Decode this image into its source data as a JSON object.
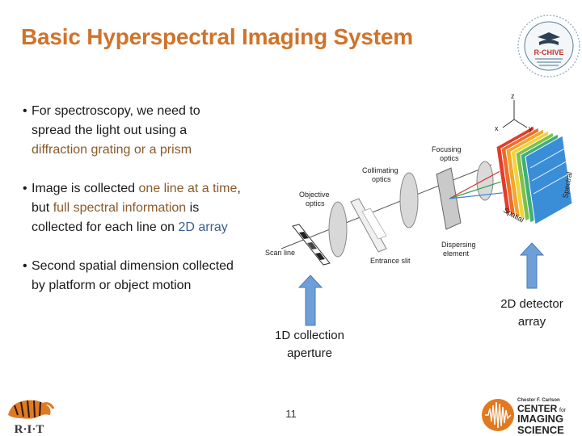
{
  "title": "Basic Hyperspectral Imaging System",
  "bullets": [
    {
      "parts": [
        {
          "text": "For spectroscopy, we need to spread the light out using a "
        },
        {
          "text": "diffraction grating or a prism",
          "color": "brown"
        }
      ]
    },
    {
      "parts": [
        {
          "text": "Image is collected "
        },
        {
          "text": "one line at a time",
          "color": "brown"
        },
        {
          "text": ", but "
        },
        {
          "text": "full spectral information",
          "color": "brown"
        },
        {
          "text": " is collected for each line on "
        },
        {
          "text": "2D array",
          "color": "blue"
        }
      ]
    },
    {
      "parts": [
        {
          "text": "Second spatial dimension collected by platform or object motion"
        }
      ]
    }
  ],
  "diagram": {
    "labels": {
      "scan_line": "Scan line",
      "objective_optics_1": "Objective",
      "objective_optics_2": "optics",
      "collimating_optics_1": "Collimating",
      "collimating_optics_2": "optics",
      "focusing_optics_1": "Focusing",
      "focusing_optics_2": "optics",
      "entrance_slit": "Entrance slit",
      "dispersing_element_1": "Dispersing",
      "dispersing_element_2": "element",
      "spatial": "Spatial",
      "spectral": "Spectral",
      "axis_x": "x",
      "axis_y": "y",
      "axis_z": "z"
    }
  },
  "captions": {
    "collection_aperture_1": "1D collection",
    "collection_aperture_2": "aperture",
    "detector_array_1": "2D detector",
    "detector_array_2": "array"
  },
  "page_number": "11",
  "logos": {
    "seal_text": "R-CHIVE",
    "rit_text": "R·I·T",
    "cis_line1": "Chester F. Carlson",
    "cis_line2": "CENTER",
    "cis_for": "for",
    "cis_line3": "IMAGING",
    "cis_line4": "SCIENCE"
  },
  "colors": {
    "title": "#d0732a",
    "highlight_brown": "#8a5a2b",
    "highlight_blue": "#3a5f8f",
    "arrow_fill": "#6f9fd8"
  }
}
